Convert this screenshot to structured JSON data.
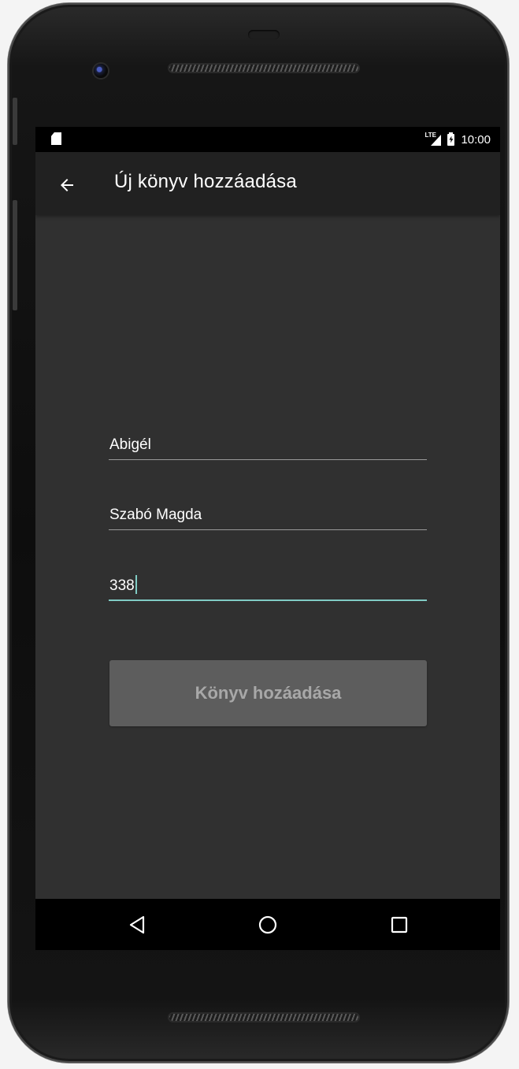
{
  "status_bar": {
    "time": "10:00",
    "signal_label": "LTE",
    "icons": [
      "sd-card-icon",
      "signal-icon",
      "battery-charging-icon"
    ]
  },
  "app_bar": {
    "back_icon": "arrow-left-icon",
    "title": "Új könyv hozzáadása"
  },
  "form": {
    "title_value": "Abigél",
    "author_value": "Szabó Magda",
    "pages_value": "338",
    "submit_label": "Könyv hozáadása"
  },
  "nav_bar": {
    "icons": [
      "back-triangle-icon",
      "home-circle-icon",
      "recents-square-icon"
    ]
  },
  "colors": {
    "screen_background": "#303030",
    "app_bar_background": "#212121",
    "accent": "#80cbc4",
    "button_background": "#5d5d5d",
    "button_text": "#a8a8a8"
  }
}
